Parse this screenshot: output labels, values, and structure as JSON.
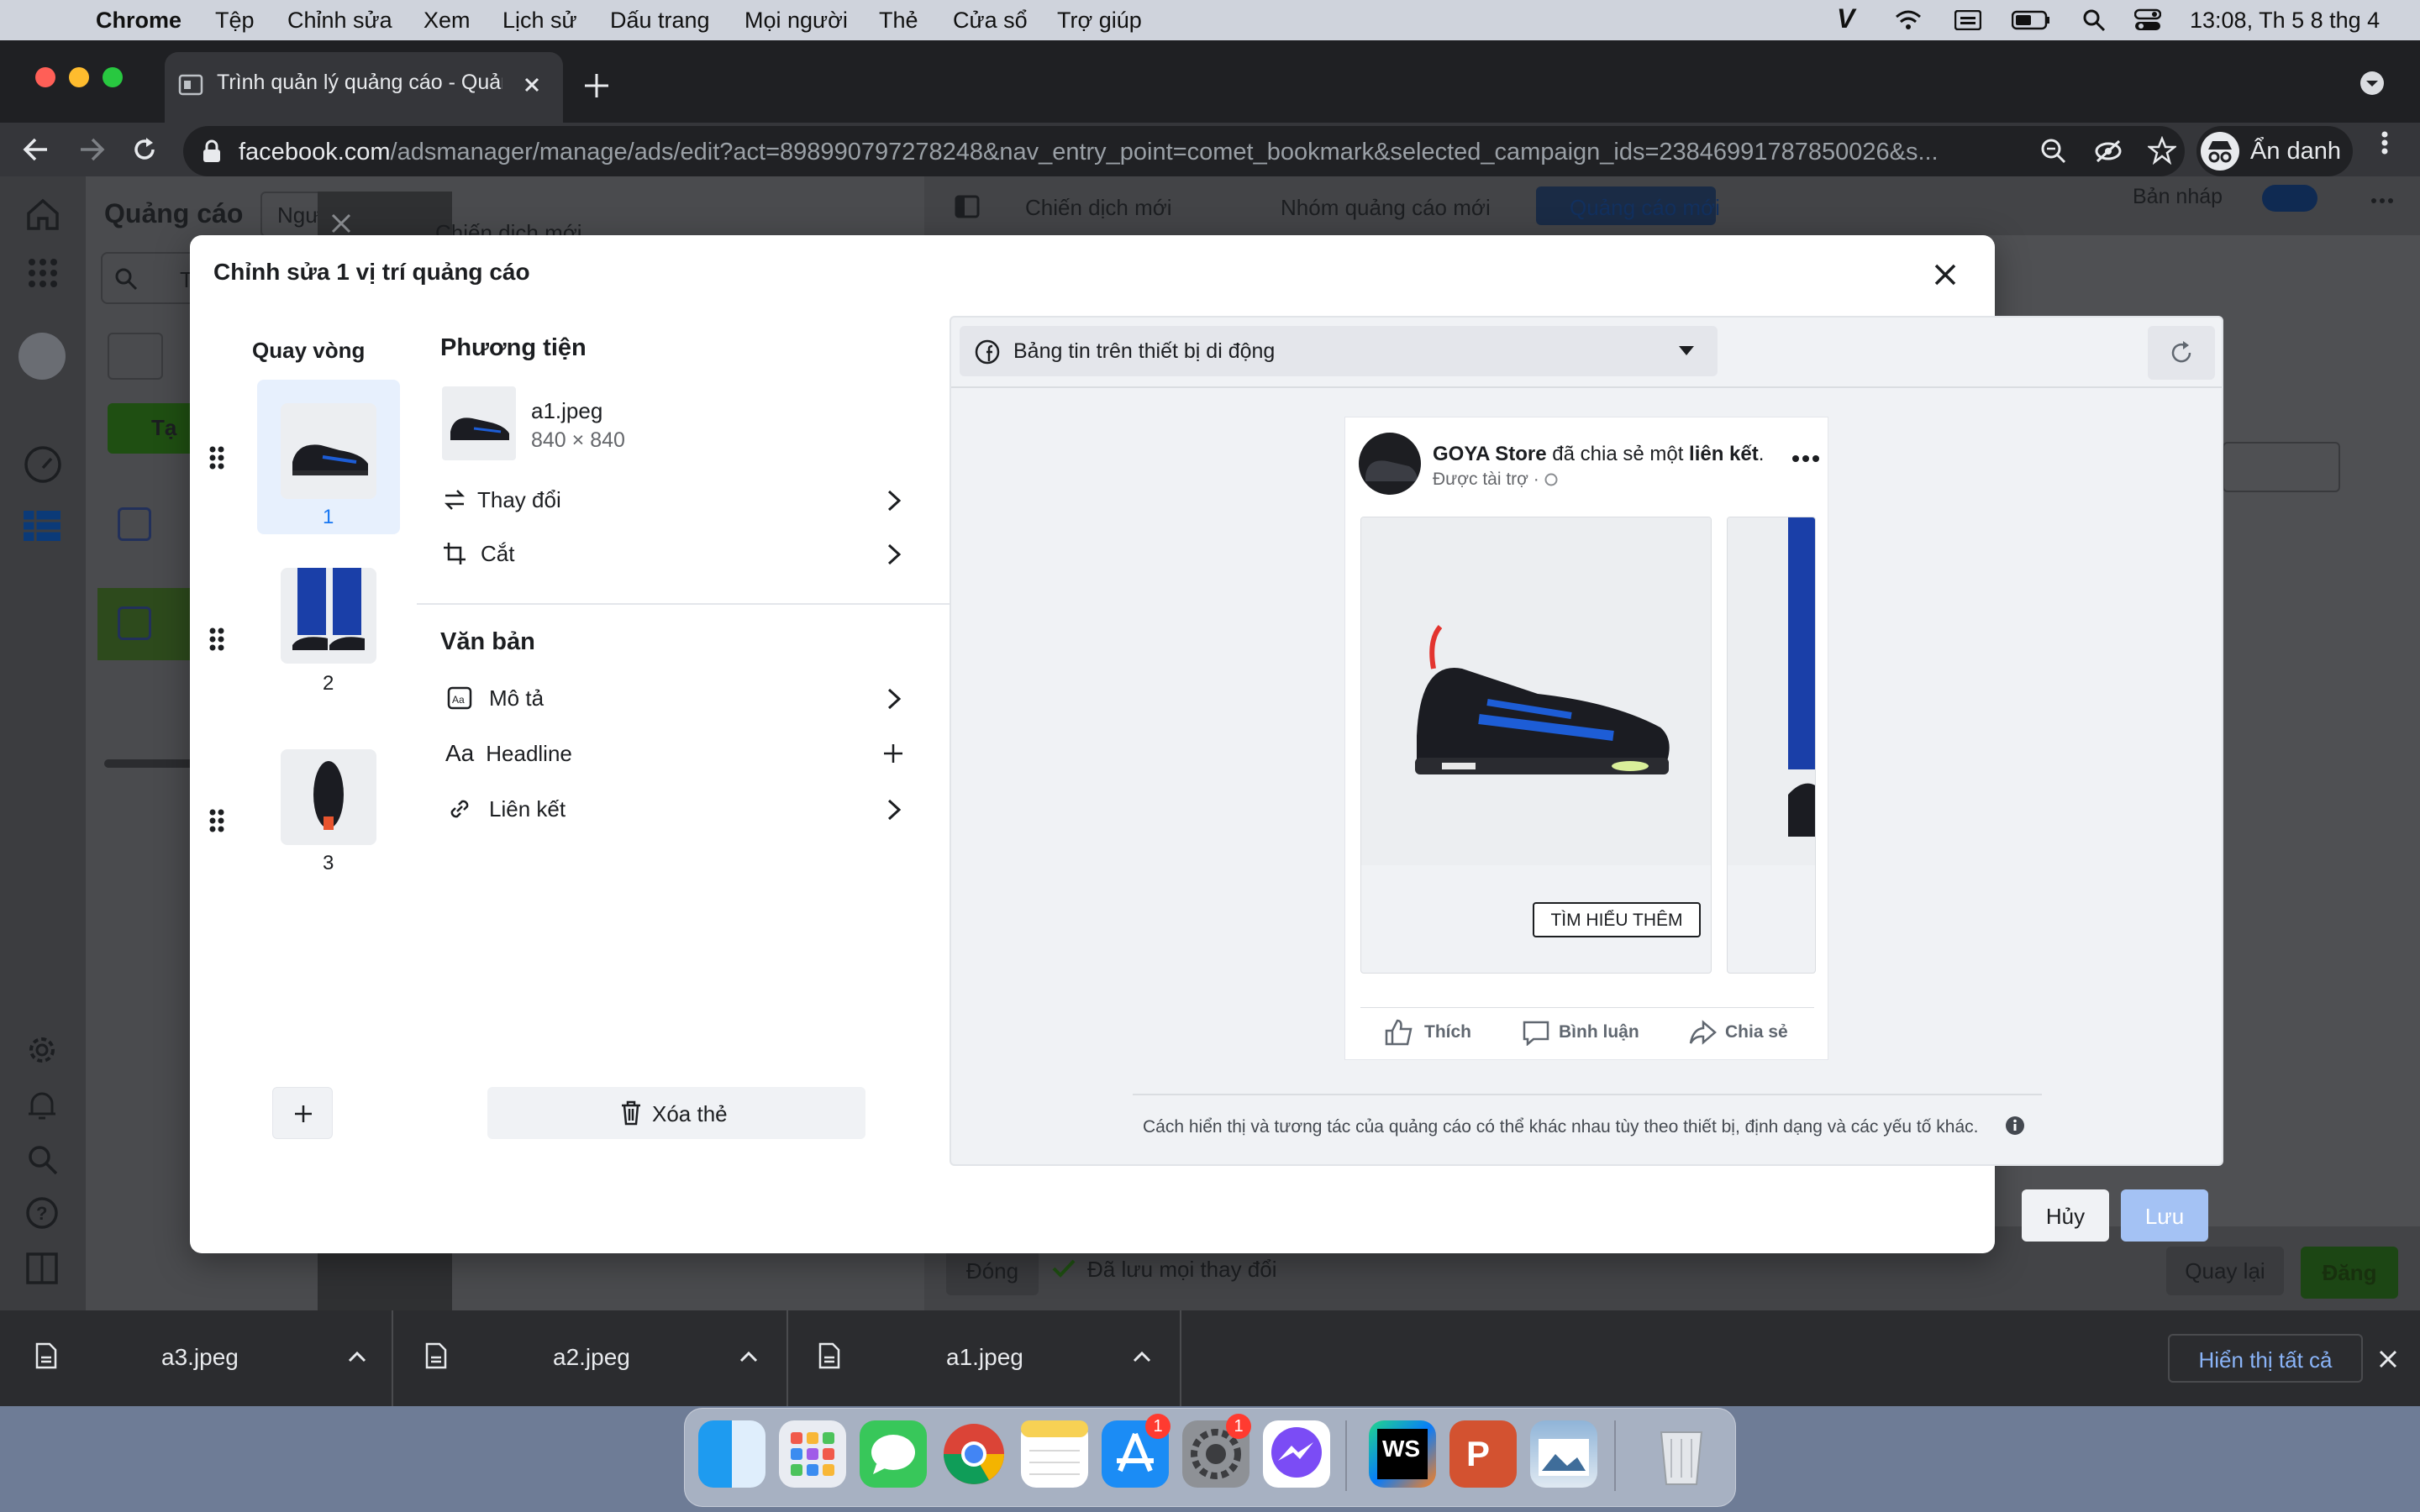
{
  "menubar": {
    "app": "Chrome",
    "items": [
      "Tệp",
      "Chỉnh sửa",
      "Xem",
      "Lịch sử",
      "Dấu trang",
      "Mọi người",
      "Thẻ",
      "Cửa sổ",
      "Trợ giúp"
    ],
    "clock": "13:08, Th 5 8 thg 4"
  },
  "browser": {
    "tab_title": "Trình quản lý quảng cáo - Quản",
    "url_domain": "facebook.com",
    "url_path": "/adsmanager/manage/ads/edit?act=898990797278248&nav_entry_point=comet_bookmark&selected_campaign_ids=23846991787850026&s...",
    "profile_label": "Ẩn danh"
  },
  "background": {
    "sidebar_title": "Quảng cáo",
    "filter_tab": "Ngư",
    "search_placeholder": "Tìm",
    "create_button": "Tạ",
    "campaign_label": "Chiến dịch mới",
    "breadcrumb": [
      "Chiến dịch mới",
      "Nhóm quảng cáo mới",
      "Quảng cáo mới"
    ],
    "draft_label": "Bản nháp",
    "close_button": "Đóng",
    "saved_status": "Đã lưu mọi thay đổi",
    "back_button": "Quay lại",
    "publish_button": "Đăng"
  },
  "modal": {
    "title": "Chỉnh sửa 1 vị trí quảng cáo",
    "carousel_title": "Quay vòng",
    "cards": [
      {
        "number": "1"
      },
      {
        "number": "2"
      },
      {
        "number": "3"
      }
    ],
    "media_title": "Phương tiện",
    "file_name": "a1.jpeg",
    "file_dims": "840 × 840",
    "change_label": "Thay đổi",
    "crop_label": "Cắt",
    "text_title": "Văn bản",
    "description_label": "Mô tả",
    "headline_label": "Headline",
    "link_label": "Liên kết",
    "delete_card": "Xóa thẻ",
    "placement": "Bảng tin trên thiết bị di động",
    "post": {
      "page_name": "GOYA Store",
      "shared_text": " đã chia sẻ một ",
      "shared_link": "liên kết",
      "sponsored": "Được tài trợ ·",
      "cta": "TÌM HIỂU THÊM",
      "like": "Thích",
      "comment": "Bình luận",
      "share": "Chia sẻ"
    },
    "disclaimer": "Cách hiển thị và tương tác của quảng cáo có thể khác nhau tùy theo thiết bị, định dạng và các yếu tố khác.",
    "cancel": "Hủy",
    "save": "Lưu"
  },
  "downloads": {
    "files": [
      "a3.jpeg",
      "a2.jpeg",
      "a1.jpeg"
    ],
    "show_all": "Hiển thị tất cả"
  },
  "dock": {
    "apps": [
      "finder-icon",
      "launchpad-icon",
      "messages-icon",
      "chrome-icon",
      "notes-icon",
      "app-store-icon",
      "system-preferences-icon",
      "messenger-icon",
      "webstorm-icon",
      "powerpoint-icon",
      "preview-icon",
      "trash-icon"
    ],
    "app_store_badge": "1",
    "system_prefs_badge": "1"
  },
  "colors": {
    "accent": "#1877f2",
    "publish": "#2e8b2e",
    "save_disabled": "#a4c2f4"
  }
}
